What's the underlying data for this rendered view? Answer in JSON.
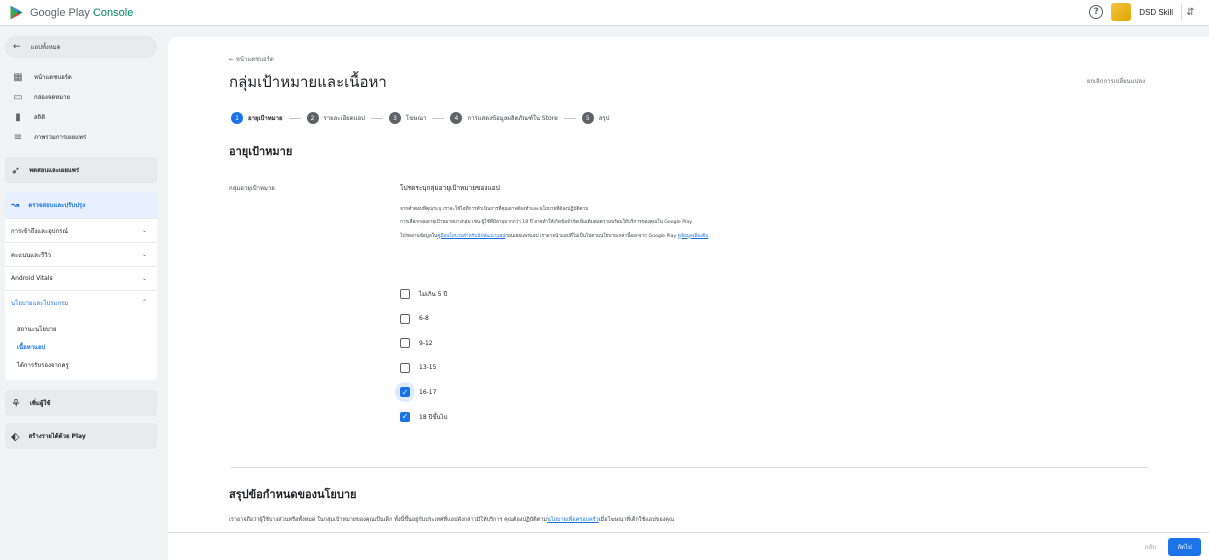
{
  "app": {
    "brand_a": "Google Play ",
    "brand_b": "Console"
  },
  "account": {
    "name": "DSD Skill"
  },
  "sidebar": {
    "back_label": "แอปทั้งหมด",
    "nav": [
      {
        "icon": "dashboard-icon",
        "label": "หน้าแดชบอร์ด"
      },
      {
        "icon": "inbox-icon",
        "label": "กล่องจดหมาย"
      },
      {
        "icon": "stats-icon",
        "label": "สถิติ"
      },
      {
        "icon": "publishing-overview-icon",
        "label": "ภาพรวมการเผยแพร่"
      }
    ],
    "test_release": "ทดสอบและเผยแพร่",
    "monitor": "ตรวจสอบและปรับปรุง",
    "accordions": [
      {
        "label": "การเข้าถึงและอุปกรณ์"
      },
      {
        "label": "คะแนนและรีวิว"
      },
      {
        "label": "Android Vitals"
      }
    ],
    "policy": {
      "label": "นโยบายและโปรแกรม",
      "items": [
        "สถานะนโยบาย",
        "เนื้อหาแอป",
        "ได้การรับรองจากครู"
      ]
    },
    "grow_users": "เพิ่มผู้ใช้",
    "monetize": "สร้างรายได้ด้วย Play"
  },
  "main": {
    "breadcrumb": "← หน้าแดชบอร์ด",
    "title": "กลุ่มเป้าหมายและเนื้อหา",
    "discard": "ยกเลิกการเปลี่ยนแปลง",
    "steps": [
      {
        "num": "1",
        "label": "อายุเป้าหมาย"
      },
      {
        "num": "2",
        "label": "รายละเอียดแอป"
      },
      {
        "num": "3",
        "label": "โฆษณา"
      },
      {
        "num": "4",
        "label": "การแสดงข้อมูลผลิตภัณฑ์ใน Store"
      },
      {
        "num": "5",
        "label": "สรุป"
      }
    ],
    "section_title": "อายุเป้าหมาย",
    "field_label": "กลุ่มอายุเป้าหมาย",
    "prompt": "โปรดระบุกลุ่มอายุเป้าหมายของแอป",
    "desc1": "จากคำตอบที่คุณระบุ เราจะใช้ไอทีการดำเนินการที่คุณอาจต้องทำและนโยบายที่ต้องปฏิบัติตาม",
    "desc2": "การเลือกกลุ่มอายุเป้าหมายบางกลุ่ม เช่น ผู้ใช้ที่มีอายุมากกว่า 18 ปี อาจทำให้เกิดข้อจำกัดเพิ่มเติมต่อความพร้อมให้บริการของคุณใน Google Play",
    "desc3_a": "โปรดอ่านข้อมูลใน",
    "desc3_link": "คู่มือนโยบายสำหรับนักพัฒนาแอป",
    "desc3_b": "ก่อนเผยแพร่แอป เราอาจนำแอปที่ไม่เป็นไปตามนโยบายเหล่านี้ออกจาก Google Play ",
    "desc3_link2": "ดูข้อมูลเพิ่มเติม",
    "ages": [
      {
        "label": "ไม่เกิน 5 ปี",
        "checked": false
      },
      {
        "label": "6-8",
        "checked": false
      },
      {
        "label": "9-12",
        "checked": false
      },
      {
        "label": "13-15",
        "checked": false
      },
      {
        "label": "16-17",
        "checked": true
      },
      {
        "label": "18 ปีขึ้นไป",
        "checked": true
      }
    ],
    "summary_title": "สรุปข้อกำหนดของนโยบาย",
    "summary_a": "เราอาจถือว่าผู้ใช้บางส่วนหรือทั้งหมด ในกลุ่มเป้าหมายของคุณเป็นเด็ก ทั้งนี้ขึ้นอยู่กับประเทศที่แอปดังกล่าวมีให้บริการ คุณต้องปฏิบัติตาม",
    "summary_link": "นโยบายเพื่อครอบครัว",
    "summary_b": "เมื่อโฆษณาที่เด็กใช้แอปของคุณ"
  },
  "footer": {
    "back": "กลับ",
    "next": "ถัดไป"
  }
}
